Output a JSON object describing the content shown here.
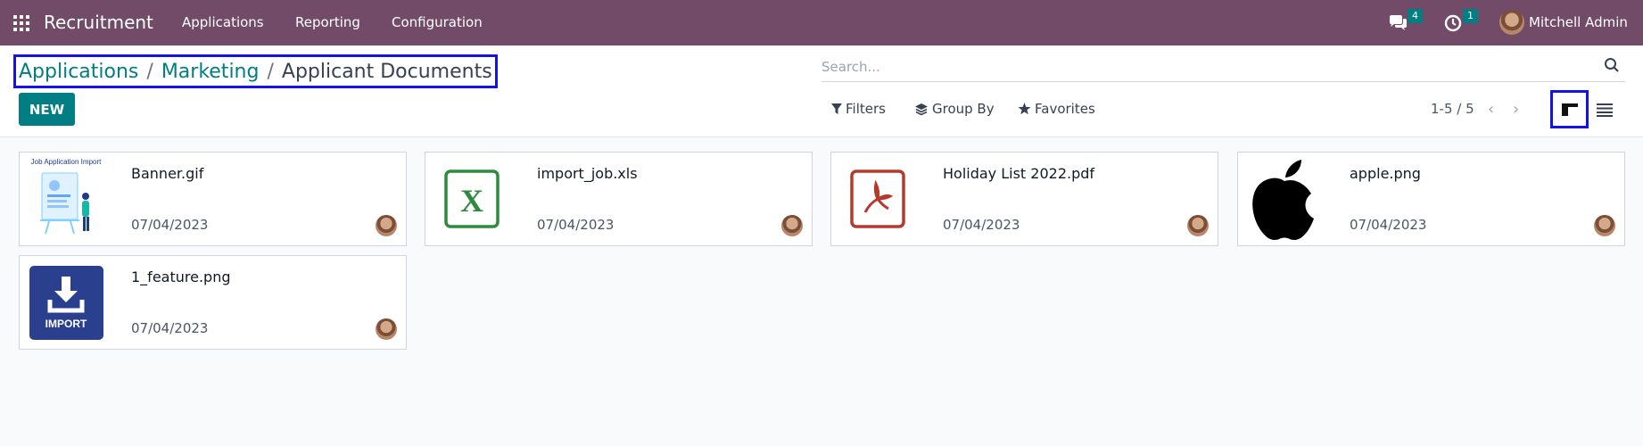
{
  "navbar": {
    "app_name": "Recruitment",
    "menu": [
      "Applications",
      "Reporting",
      "Configuration"
    ],
    "messages_count": "4",
    "activities_count": "1",
    "user_name": "Mitchell Admin"
  },
  "breadcrumb": {
    "items": [
      "Applications",
      "Marketing"
    ],
    "separator": "/",
    "current": "Applicant Documents"
  },
  "toolbar": {
    "new_label": "NEW",
    "search_placeholder": "Search...",
    "filters_label": "Filters",
    "group_by_label": "Group By",
    "favorites_label": "Favorites",
    "pager": "1-5 / 5"
  },
  "documents": [
    {
      "name": "Banner.gif",
      "date": "07/04/2023",
      "thumb": "banner-thumbnail",
      "thumb_text": "Job Application Import"
    },
    {
      "name": "import_job.xls",
      "date": "07/04/2023",
      "thumb": "excel-icon"
    },
    {
      "name": "Holiday List 2022.pdf",
      "date": "07/04/2023",
      "thumb": "pdf-icon"
    },
    {
      "name": "apple.png",
      "date": "07/04/2023",
      "thumb": "apple-logo"
    },
    {
      "name": "1_feature.png",
      "date": "07/04/2023",
      "thumb": "import-icon",
      "thumb_text": "IMPORT"
    }
  ],
  "colors": {
    "navbar": "#714b67",
    "accent": "#017e84",
    "highlight_border": "#1412e6"
  }
}
